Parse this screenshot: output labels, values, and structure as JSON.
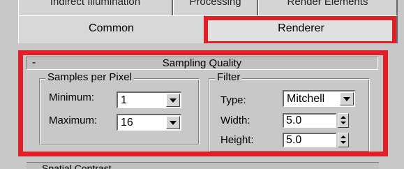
{
  "top_tabs": [
    "Indirect Illumination",
    "Processing",
    "Render Elements"
  ],
  "tabs": {
    "common": "Common",
    "renderer": "Renderer"
  },
  "rollout": {
    "toggle": "-",
    "title": "Sampling Quality"
  },
  "samples": {
    "title": "Samples per Pixel",
    "minimum_label": "Minimum:",
    "minimum_value": "1",
    "maximum_label": "Maximum:",
    "maximum_value": "16"
  },
  "filter": {
    "title": "Filter",
    "type_label": "Type:",
    "type_value": "Mitchell",
    "width_label": "Width:",
    "width_value": "5.0",
    "height_label": "Height:",
    "height_value": "5.0"
  },
  "next_rollout": "Spatial Contrast",
  "colors": {
    "highlight": "#e21f26",
    "panel": "#c8c8c8"
  }
}
